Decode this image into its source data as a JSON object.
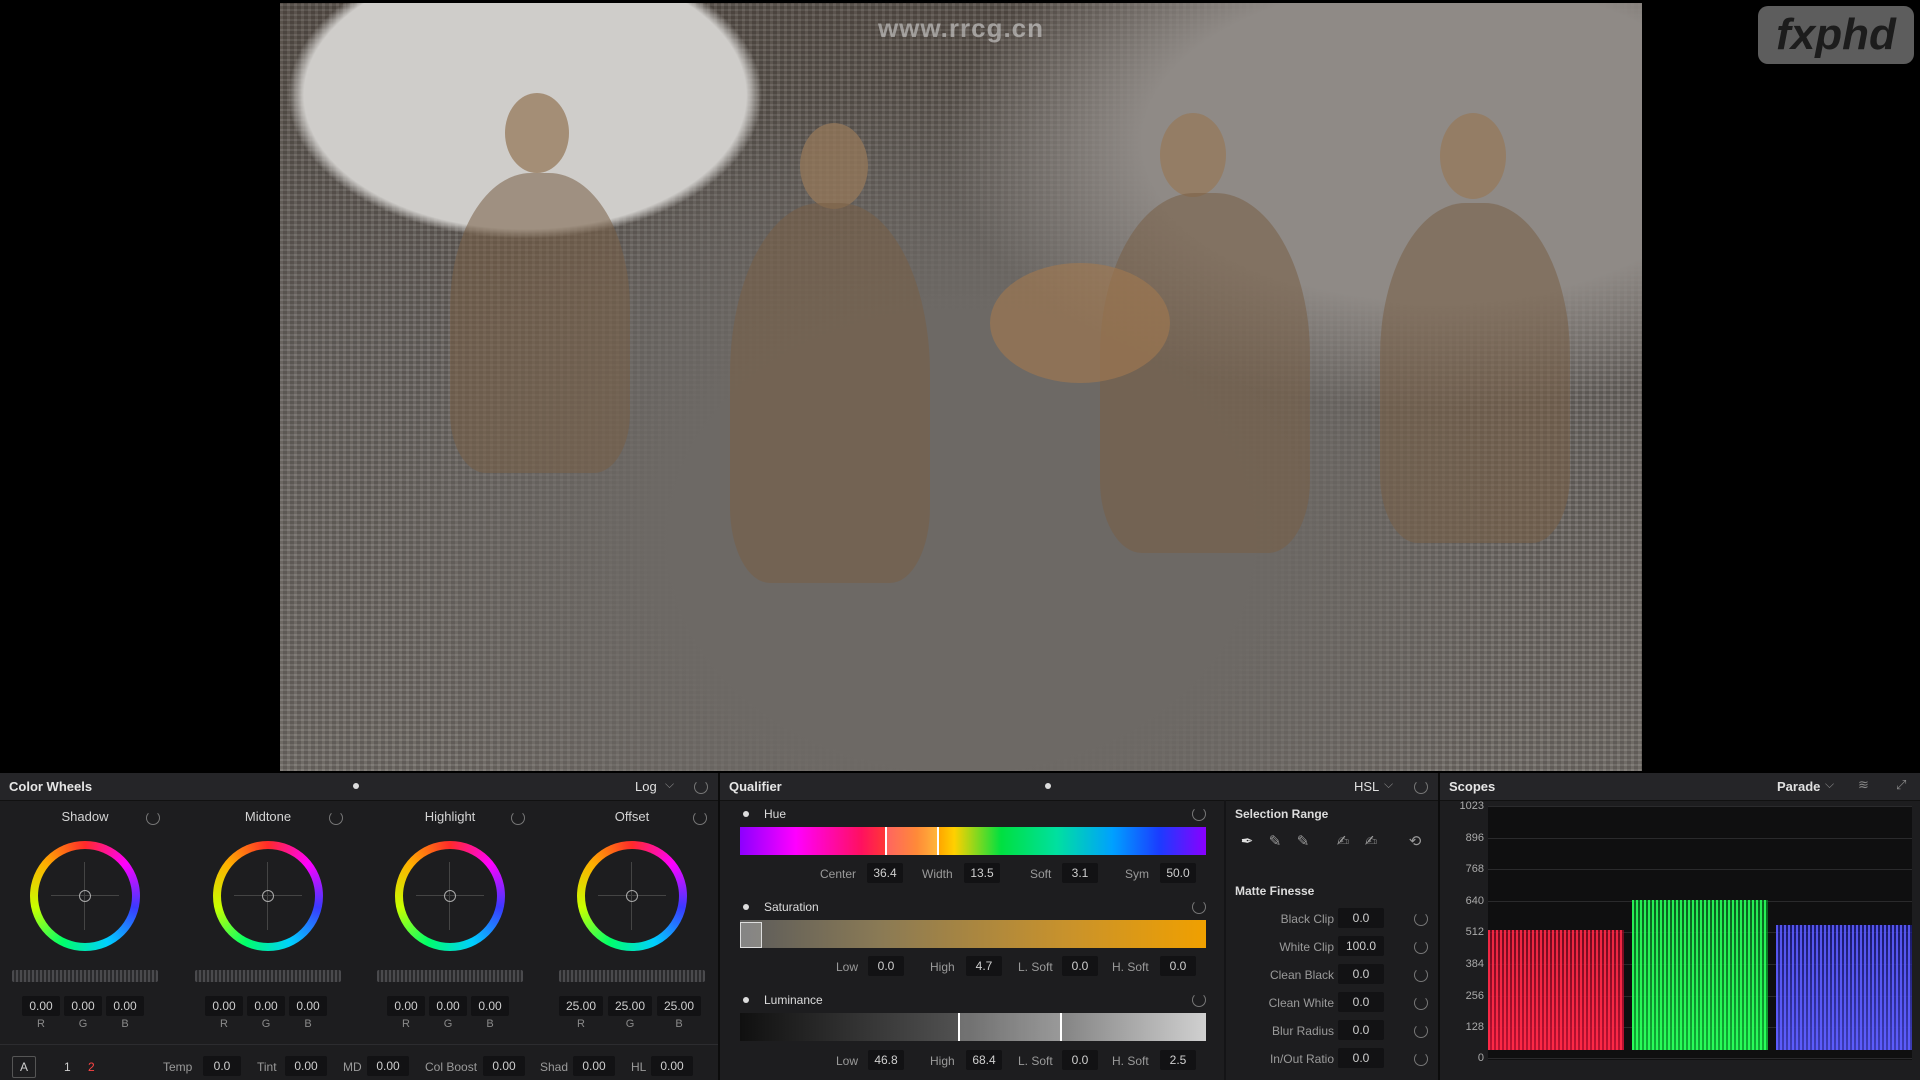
{
  "viewer": {
    "watermark_url": "www.rrcg.cn",
    "logo": "fxphd"
  },
  "color_wheels": {
    "title": "Color Wheels",
    "mode": "Log",
    "wheels": [
      {
        "label": "Shadow",
        "values": [
          "0.00",
          "0.00",
          "0.00"
        ]
      },
      {
        "label": "Midtone",
        "values": [
          "0.00",
          "0.00",
          "0.00"
        ]
      },
      {
        "label": "Highlight",
        "values": [
          "0.00",
          "0.00",
          "0.00"
        ]
      },
      {
        "label": "Offset",
        "values": [
          "25.00",
          "25.00",
          "25.00"
        ]
      }
    ],
    "rgb_labels": [
      "R",
      "G",
      "B"
    ],
    "bottom": {
      "mode_a": "A",
      "page_1": "1",
      "page_2": "2",
      "temp_label": "Temp",
      "temp_value": "0.0",
      "tint_label": "Tint",
      "tint_value": "0.00",
      "md_label": "MD",
      "md_value": "0.00",
      "colboost_label": "Col Boost",
      "colboost_value": "0.00",
      "shad_label": "Shad",
      "shad_value": "0.00",
      "hl_label": "HL",
      "hl_value": "0.00"
    }
  },
  "qualifier": {
    "title": "Qualifier",
    "mode": "HSL",
    "hue": {
      "label": "Hue",
      "center_label": "Center",
      "center": "36.4",
      "width_label": "Width",
      "width": "13.5",
      "soft_label": "Soft",
      "soft": "3.1",
      "sym_label": "Sym",
      "sym": "50.0"
    },
    "saturation": {
      "label": "Saturation",
      "low_label": "Low",
      "low": "0.0",
      "high_label": "High",
      "high": "4.7",
      "lsoft_label": "L. Soft",
      "lsoft": "0.0",
      "hsoft_label": "H. Soft",
      "hsoft": "0.0"
    },
    "luminance": {
      "label": "Luminance",
      "low_label": "Low",
      "low": "46.8",
      "high_label": "High",
      "high": "68.4",
      "lsoft_label": "L. Soft",
      "lsoft": "0.0",
      "hsoft_label": "H. Soft",
      "hsoft": "2.5"
    },
    "selection_range": "Selection Range",
    "matte_finesse": {
      "title": "Matte Finesse",
      "rows": [
        {
          "label": "Black Clip",
          "value": "0.0"
        },
        {
          "label": "White Clip",
          "value": "100.0"
        },
        {
          "label": "Clean Black",
          "value": "0.0"
        },
        {
          "label": "Clean White",
          "value": "0.0"
        },
        {
          "label": "Blur Radius",
          "value": "0.0"
        },
        {
          "label": "In/Out Ratio",
          "value": "0.0"
        }
      ]
    }
  },
  "scopes": {
    "title": "Scopes",
    "mode": "Parade",
    "y_ticks": [
      "1023",
      "896",
      "768",
      "640",
      "512",
      "384",
      "256",
      "128",
      "0"
    ]
  }
}
